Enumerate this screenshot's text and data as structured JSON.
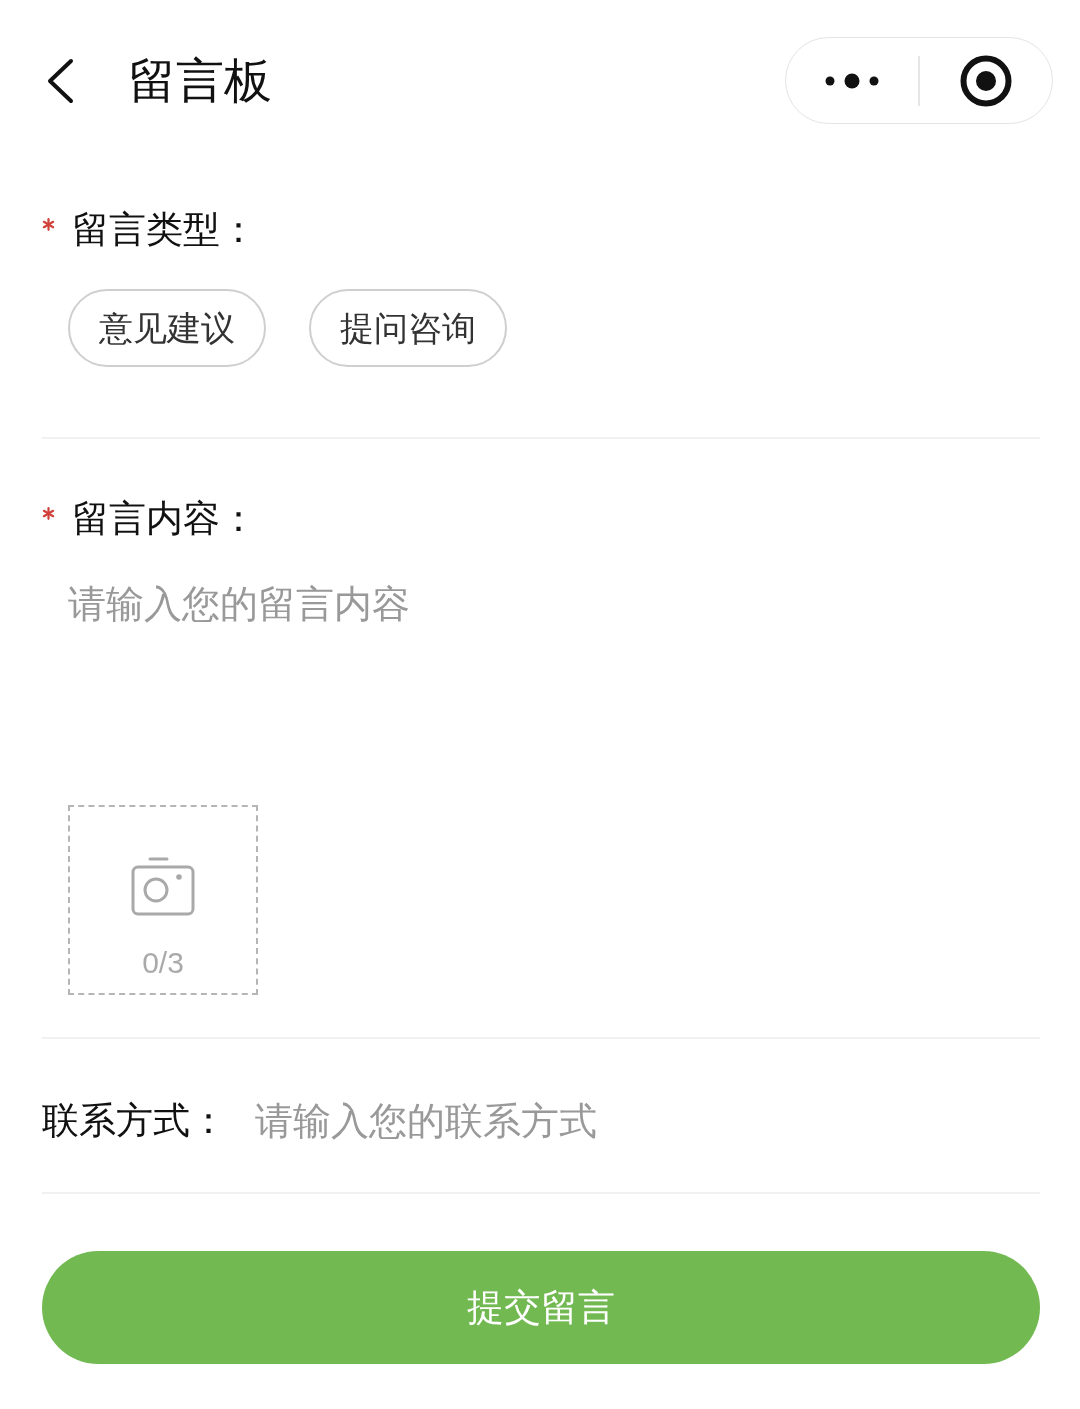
{
  "header": {
    "title": "留言板"
  },
  "message_type": {
    "label": "留言类型：",
    "required": true,
    "options": [
      {
        "label": "意见建议",
        "selected": false
      },
      {
        "label": "提问咨询",
        "selected": false
      }
    ]
  },
  "message_content": {
    "label": "留言内容：",
    "required": true,
    "placeholder": "请输入您的留言内容",
    "upload": {
      "count": "0/3"
    }
  },
  "contact": {
    "label": "联系方式：",
    "required": false,
    "placeholder": "请输入您的联系方式"
  },
  "submit": {
    "label": "提交留言"
  }
}
